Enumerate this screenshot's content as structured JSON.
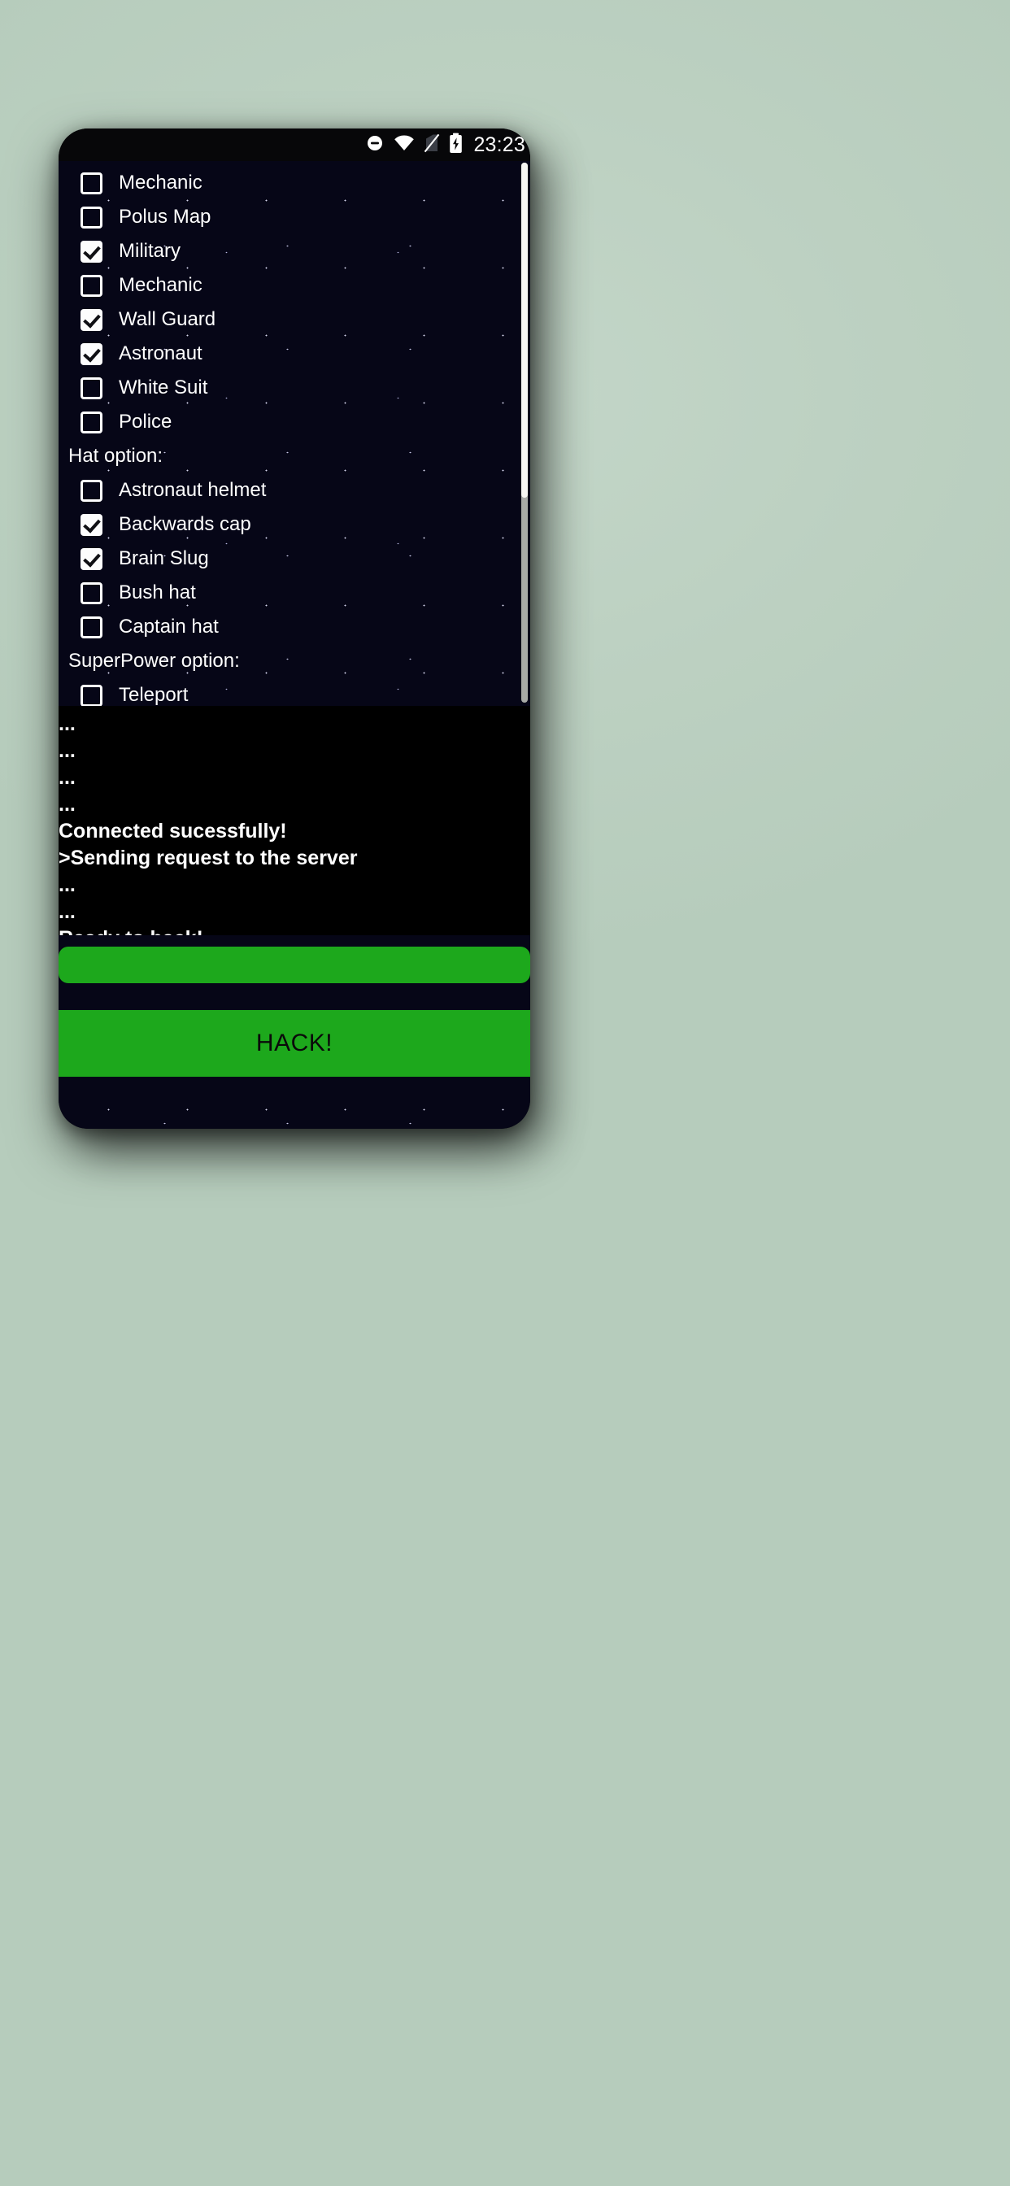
{
  "statusbar": {
    "icons": [
      "do-not-disturb-icon",
      "wifi-icon",
      "no-sim-icon",
      "battery-charging-icon"
    ],
    "clock": "23:23"
  },
  "options_panel": {
    "rows": [
      {
        "kind": "checkbox",
        "label": "Mechanic",
        "checked": false
      },
      {
        "kind": "checkbox",
        "label": "Polus Map",
        "checked": false
      },
      {
        "kind": "checkbox",
        "label": "Military",
        "checked": true
      },
      {
        "kind": "checkbox",
        "label": "Mechanic",
        "checked": false
      },
      {
        "kind": "checkbox",
        "label": "Wall Guard",
        "checked": true
      },
      {
        "kind": "checkbox",
        "label": "Astronaut",
        "checked": true
      },
      {
        "kind": "checkbox",
        "label": "White Suit",
        "checked": false
      },
      {
        "kind": "checkbox",
        "label": "Police",
        "checked": false
      },
      {
        "kind": "header",
        "label": "Hat option:"
      },
      {
        "kind": "checkbox",
        "label": "Astronaut helmet",
        "checked": false
      },
      {
        "kind": "checkbox",
        "label": "Backwards cap",
        "checked": true
      },
      {
        "kind": "checkbox",
        "label": "Brain Slug",
        "checked": true
      },
      {
        "kind": "checkbox",
        "label": "Bush hat",
        "checked": false
      },
      {
        "kind": "checkbox",
        "label": "Captain hat",
        "checked": false
      },
      {
        "kind": "header",
        "label": "SuperPower option:"
      },
      {
        "kind": "checkbox",
        "label": "Teleport",
        "checked": false
      }
    ]
  },
  "scrollbar": {
    "thumb_percent": 62
  },
  "console": {
    "lines": [
      "...",
      "...",
      "...",
      "...",
      "Connected sucessfully!",
      ">Sending request to the server",
      "...",
      "...",
      "Ready to hack!"
    ]
  },
  "buttons": {
    "progress_label": "",
    "hack_label": "HACK!",
    "accent_green": "#1da81c"
  }
}
